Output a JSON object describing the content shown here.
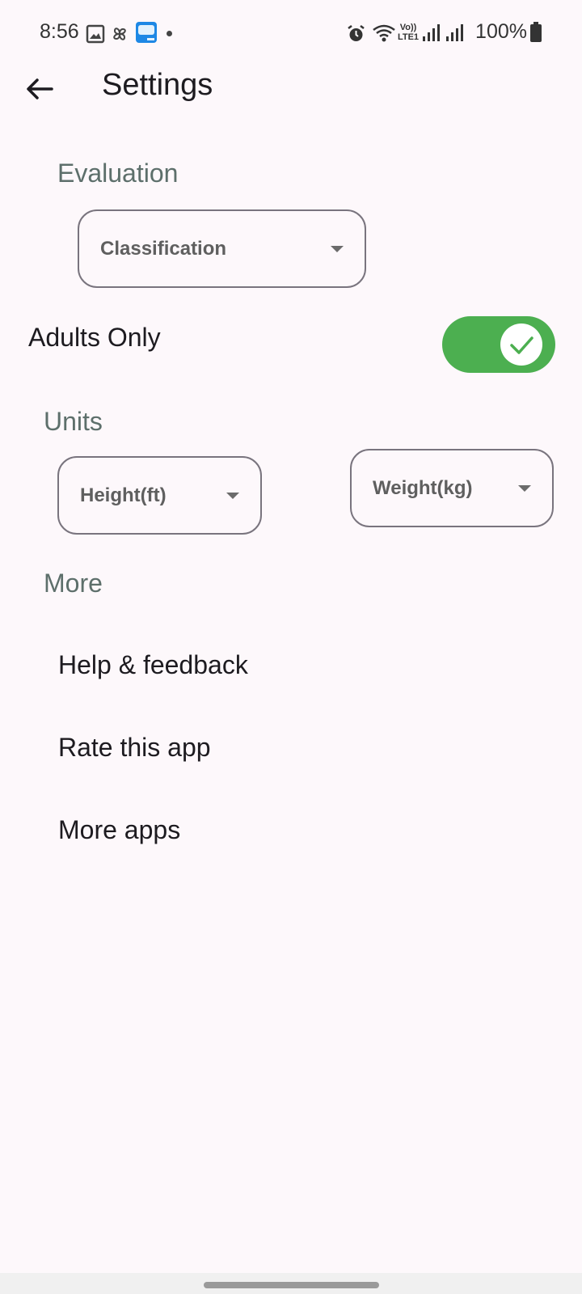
{
  "status_bar": {
    "time": "8:56",
    "battery": "100%",
    "left_icons": [
      "gallery-icon",
      "pinwheel-icon",
      "app-notification-icon",
      "dot-icon"
    ],
    "right_icons": [
      "alarm-icon",
      "wifi-icon",
      "volte-lte-icon",
      "signal-icon",
      "signal-icon",
      "battery-icon"
    ],
    "volte_label": "Vo)) LTE1"
  },
  "app_bar": {
    "title": "Settings",
    "back_icon": "arrow-back-icon"
  },
  "sections": {
    "evaluation": {
      "title": "Evaluation",
      "dropdown_value": "Classification"
    },
    "adults_only": {
      "label": "Adults Only",
      "enabled": true
    },
    "units": {
      "title": "Units",
      "height_value": "Height(ft)",
      "weight_value": "Weight(kg)"
    },
    "more": {
      "title": "More",
      "items": [
        {
          "label": "Help & feedback"
        },
        {
          "label": "Rate this app"
        },
        {
          "label": "More apps"
        }
      ]
    }
  },
  "colors": {
    "background": "#fdf8fb",
    "accent": "#4caf50",
    "section_title": "#5d6f6b",
    "outline": "#79747e"
  }
}
